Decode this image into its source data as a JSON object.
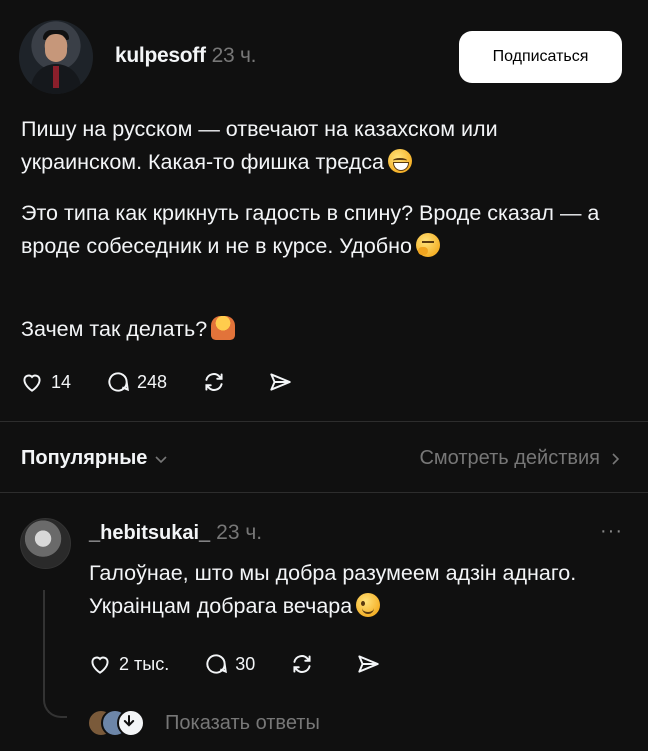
{
  "post": {
    "username": "kulpesoff",
    "time": "23 ч.",
    "follow_label": "Подписаться",
    "paragraph1": "Пишу на русском — отвечают на казахском или украинском. Какая-то фишка тредса",
    "paragraph2": "Это типа как крикнуть гадость в спину? Вроде сказал — а вроде собеседник и не в курсе. Удобно",
    "paragraph3": "Зачем так делать?",
    "likes": "14",
    "comments": "248"
  },
  "filter": {
    "sort_label": "Популярные",
    "activity_label": "Смотреть действия"
  },
  "reply": {
    "username": "_hebitsukai_",
    "time": "23 ч.",
    "more": "···",
    "text": "Галоўнае, што мы добра разумеем адзін аднаго. Украінцам добрага вечара",
    "likes": "2 тыс.",
    "comments": "30",
    "show_replies_label": "Показать ответы"
  },
  "colors": {
    "background": "#101010",
    "text": "#f3f5f7",
    "muted": "#777777",
    "divider": "#2d2d2d"
  }
}
